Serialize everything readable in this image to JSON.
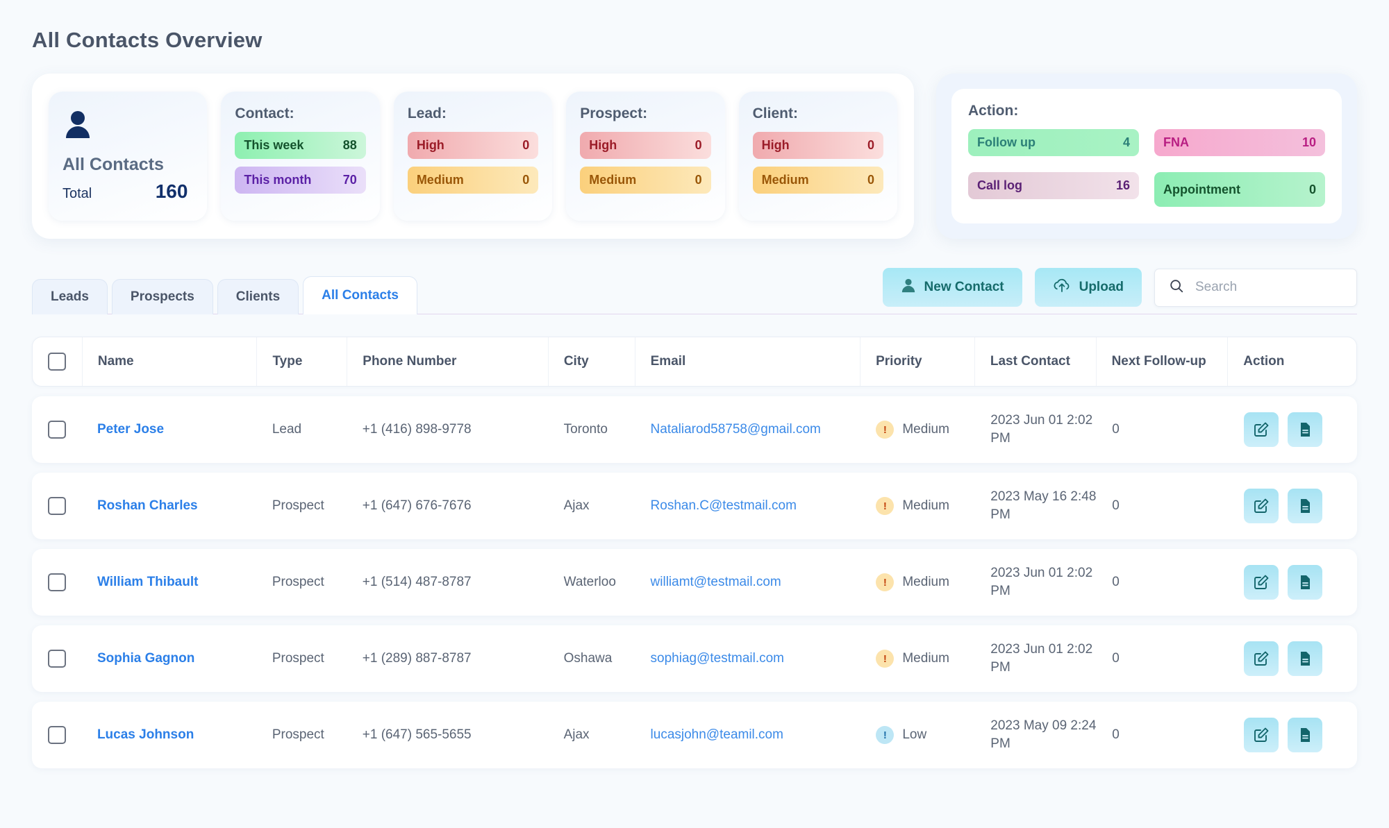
{
  "page": {
    "title": "All Contacts Overview"
  },
  "summary": {
    "total_card": {
      "icon": "person-icon",
      "name": "All Contacts",
      "total_label": "Total",
      "total_value": "160"
    },
    "cards": [
      {
        "heading": "Contact:",
        "rows": [
          {
            "label": "This week",
            "value": "88",
            "style": "pill-green"
          },
          {
            "label": "This month",
            "value": "70",
            "style": "pill-purple"
          }
        ]
      },
      {
        "heading": "Lead:",
        "rows": [
          {
            "label": "High",
            "value": "0",
            "style": "pill-red"
          },
          {
            "label": "Medium",
            "value": "0",
            "style": "pill-amber"
          }
        ]
      },
      {
        "heading": "Prospect:",
        "rows": [
          {
            "label": "High",
            "value": "0",
            "style": "pill-red"
          },
          {
            "label": "Medium",
            "value": "0",
            "style": "pill-amber"
          }
        ]
      },
      {
        "heading": "Client:",
        "rows": [
          {
            "label": "High",
            "value": "0",
            "style": "pill-red"
          },
          {
            "label": "Medium",
            "value": "0",
            "style": "pill-amber"
          }
        ]
      }
    ],
    "action_card": {
      "heading": "Action:",
      "items": [
        {
          "label": "Follow up",
          "value": "4",
          "style": "pill-followup"
        },
        {
          "label": "FNA",
          "value": "10",
          "style": "pill-fna"
        },
        {
          "label": "Call log",
          "value": "16",
          "style": "pill-calllog"
        },
        {
          "label": "Appointment",
          "value": "0",
          "style": "pill-appointment"
        }
      ]
    }
  },
  "tabs": [
    {
      "label": "Leads",
      "active": false
    },
    {
      "label": "Prospects",
      "active": false
    },
    {
      "label": "Clients",
      "active": false
    },
    {
      "label": "All Contacts",
      "active": true
    }
  ],
  "toolbar": {
    "new_contact_label": "New Contact",
    "upload_label": "Upload",
    "search_placeholder": "Search",
    "search_value": ""
  },
  "table": {
    "columns": [
      "Name",
      "Type",
      "Phone Number",
      "City",
      "Email",
      "Priority",
      "Last Contact",
      "Next Follow-up",
      "Action"
    ],
    "rows": [
      {
        "name": "Peter Jose",
        "type": "Lead",
        "phone": "+1 (416) 898-9778",
        "city": "Toronto",
        "email": "Nataliarod58758@gmail.com",
        "priority": "Medium",
        "priority_style": "dot-medium",
        "last_contact": "2023 Jun 01 2:02 PM",
        "next_followup": "0"
      },
      {
        "name": "Roshan Charles",
        "type": "Prospect",
        "phone": "+1 (647) 676-7676",
        "city": "Ajax",
        "email": "Roshan.C@testmail.com",
        "priority": "Medium",
        "priority_style": "dot-medium",
        "last_contact": "2023 May 16 2:48 PM",
        "next_followup": "0"
      },
      {
        "name": "William Thibault",
        "type": "Prospect",
        "phone": "+1 (514) 487-8787",
        "city": "Waterloo",
        "email": "williamt@testmail.com",
        "priority": "Medium",
        "priority_style": "dot-medium",
        "last_contact": "2023 Jun 01 2:02 PM",
        "next_followup": "0"
      },
      {
        "name": "Sophia Gagnon",
        "type": "Prospect",
        "phone": "+1 (289) 887-8787",
        "city": "Oshawa",
        "email": "sophiag@testmail.com",
        "priority": "Medium",
        "priority_style": "dot-medium",
        "last_contact": "2023 Jun 01 2:02 PM",
        "next_followup": "0"
      },
      {
        "name": "Lucas Johnson",
        "type": "Prospect",
        "phone": "+1 (647) 565-5655",
        "city": "Ajax",
        "email": "lucasjohn@teamil.com",
        "priority": "Low",
        "priority_style": "dot-low",
        "last_contact": "2023 May 09 2:24 PM",
        "next_followup": "0"
      }
    ],
    "priority_marker": "!"
  },
  "colors": {
    "accent_blue": "#2b7fe8",
    "button_cyan": "#a7e8f5",
    "navy": "#12306b",
    "page_bg": "#f7fafd"
  }
}
